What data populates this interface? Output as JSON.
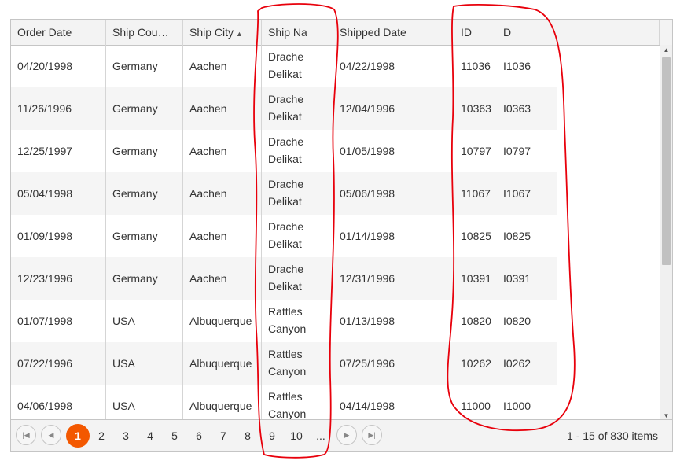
{
  "columns": [
    {
      "label": "Order Date"
    },
    {
      "label": "Ship Cou…"
    },
    {
      "label": "Ship City",
      "sort": "▲"
    },
    {
      "label": "Ship Na"
    },
    {
      "label": "Shipped Date"
    },
    {
      "label": "ID"
    },
    {
      "label": "D"
    }
  ],
  "rows": [
    {
      "order_date": "04/20/1998",
      "ship_country": "Germany",
      "ship_city": "Aachen",
      "ship_name": [
        "Drache",
        "Delikat"
      ],
      "shipped_date": "04/22/1998",
      "id": "11036",
      "d": "I1036"
    },
    {
      "order_date": "11/26/1996",
      "ship_country": "Germany",
      "ship_city": "Aachen",
      "ship_name": [
        "Drache",
        "Delikat"
      ],
      "shipped_date": "12/04/1996",
      "id": "10363",
      "d": "I0363"
    },
    {
      "order_date": "12/25/1997",
      "ship_country": "Germany",
      "ship_city": "Aachen",
      "ship_name": [
        "Drache",
        "Delikat"
      ],
      "shipped_date": "01/05/1998",
      "id": "10797",
      "d": "I0797"
    },
    {
      "order_date": "05/04/1998",
      "ship_country": "Germany",
      "ship_city": "Aachen",
      "ship_name": [
        "Drache",
        "Delikat"
      ],
      "shipped_date": "05/06/1998",
      "id": "11067",
      "d": "I1067"
    },
    {
      "order_date": "01/09/1998",
      "ship_country": "Germany",
      "ship_city": "Aachen",
      "ship_name": [
        "Drache",
        "Delikat"
      ],
      "shipped_date": "01/14/1998",
      "id": "10825",
      "d": "I0825"
    },
    {
      "order_date": "12/23/1996",
      "ship_country": "Germany",
      "ship_city": "Aachen",
      "ship_name": [
        "Drache",
        "Delikat"
      ],
      "shipped_date": "12/31/1996",
      "id": "10391",
      "d": "I0391"
    },
    {
      "order_date": "01/07/1998",
      "ship_country": "USA",
      "ship_city": "Albuquerque",
      "ship_name": [
        "Rattles",
        "Canyon"
      ],
      "shipped_date": "01/13/1998",
      "id": "10820",
      "d": "I0820"
    },
    {
      "order_date": "07/22/1996",
      "ship_country": "USA",
      "ship_city": "Albuquerque",
      "ship_name": [
        "Rattles",
        "Canyon"
      ],
      "shipped_date": "07/25/1996",
      "id": "10262",
      "d": "I0262"
    },
    {
      "order_date": "04/06/1998",
      "ship_country": "USA",
      "ship_city": "Albuquerque",
      "ship_name": [
        "Rattles",
        "Canyon"
      ],
      "shipped_date": "04/14/1998",
      "id": "11000",
      "d": "I1000"
    }
  ],
  "pager": {
    "first_icon": "first-page-icon",
    "prev_icon": "prev-page-icon",
    "next_icon": "next-page-icon",
    "last_icon": "last-page-icon",
    "pages": [
      "1",
      "2",
      "3",
      "4",
      "5",
      "6",
      "7",
      "8",
      "9",
      "10",
      "..."
    ],
    "active_page": "1",
    "info": "1 - 15 of 830 items"
  },
  "colors": {
    "accent": "#f35800",
    "annotation": "#e8000b",
    "header_bg": "#f3f3f3",
    "alt_row": "#f5f5f5"
  }
}
